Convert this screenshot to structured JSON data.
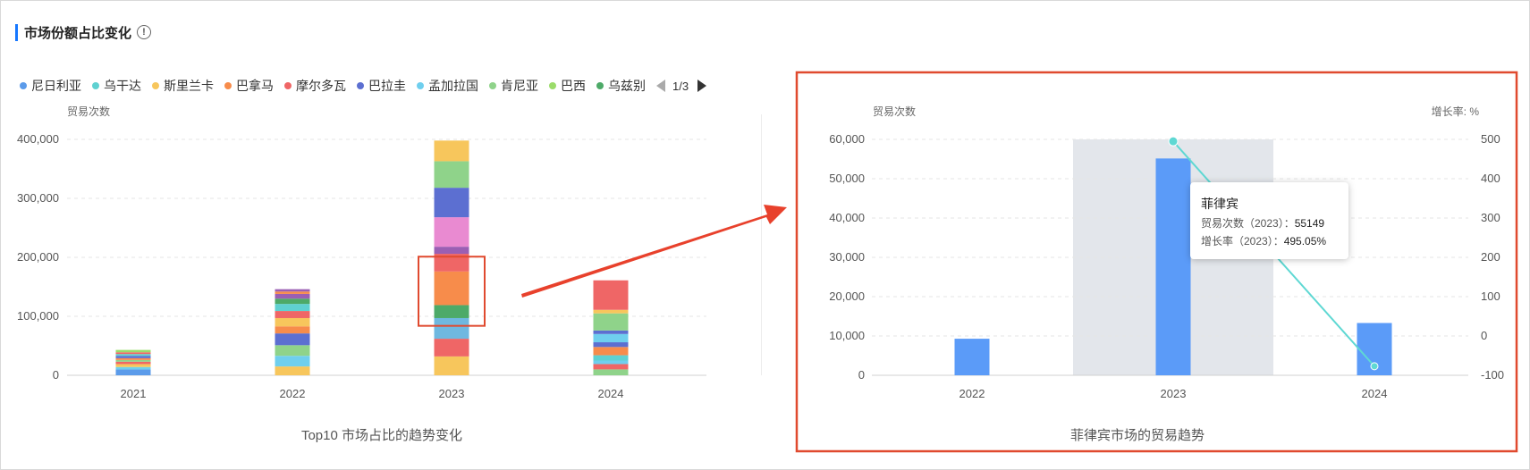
{
  "section": {
    "title": "市场份额占比变化",
    "info_icon": "info-circle-icon"
  },
  "legend": {
    "items": [
      {
        "name": "尼日利亚",
        "color": "#5b9bea"
      },
      {
        "name": "乌干达",
        "color": "#5fd1d1"
      },
      {
        "name": "斯里兰卡",
        "color": "#f7c65c"
      },
      {
        "name": "巴拿马",
        "color": "#f78c4b"
      },
      {
        "name": "摩尔多瓦",
        "color": "#ef6666"
      },
      {
        "name": "巴拉圭",
        "color": "#5c6fd1"
      },
      {
        "name": "孟加拉国",
        "color": "#6fcfee"
      },
      {
        "name": "肯尼亚",
        "color": "#8fd38a"
      },
      {
        "name": "巴西",
        "color": "#9bdc6a"
      },
      {
        "name": "乌兹别",
        "color": "#4daa68"
      }
    ],
    "page": "1/3"
  },
  "left_chart": {
    "type": "bar",
    "stacked": true,
    "title": "Top10 市场占比的趋势变化",
    "ylabel": "贸易次数",
    "ylim": [
      0,
      400000
    ],
    "yticks": [
      "0",
      "100,000",
      "200,000",
      "300,000",
      "400,000"
    ],
    "categories": [
      "2021",
      "2022",
      "2023",
      "2024"
    ],
    "stack_colors": [
      [
        "#5b9bea",
        "#6fcfee",
        "#f7c65c",
        "#ef6666",
        "#8fd38a",
        "#f78c4b",
        "#5c6fd1",
        "#5fd1d1",
        "#ef6666",
        "#9bdc6a"
      ],
      [
        "#f7c65c",
        "#6fcfee",
        "#8fd38a",
        "#5c6fd1",
        "#f78c4b",
        "#f7c65c",
        "#ef6666",
        "#5fd1d1",
        "#4daa68",
        "#9b5fb3",
        "#f78c4b",
        "#9b5fb3"
      ],
      [
        "#f7c65c",
        "#ef6666",
        "#6fb8e0",
        "#4daa68",
        "#f78c4b",
        "#ef6666",
        "#9b5fb3",
        "#e98ad1",
        "#5c6fd1",
        "#8fd38a",
        "#f7c65c"
      ],
      [
        "#8fd38a",
        "#ef6666",
        "#6fcfee",
        "#5fd1d1",
        "#f78c4b",
        "#5c6fd1",
        "#6fcfee",
        "#5c6fd1",
        "#8fd38a",
        "#f7c65c",
        "#ef6666"
      ]
    ],
    "stack_values": [
      [
        10000,
        4000,
        5000,
        4000,
        3000,
        3000,
        4000,
        3000,
        3000,
        4000
      ],
      [
        15000,
        18000,
        18000,
        20000,
        12000,
        14000,
        12000,
        12000,
        9000,
        8000,
        4000,
        4000
      ],
      [
        32000,
        30000,
        35000,
        22000,
        57000,
        30000,
        12000,
        50000,
        50000,
        45000,
        35000
      ],
      [
        10000,
        9000,
        6000,
        9000,
        14000,
        8000,
        14000,
        6000,
        29000,
        6000,
        50000
      ]
    ],
    "highlight": {
      "category": "2023",
      "from": 99000,
      "to": 186000
    }
  },
  "right_chart": {
    "type": "bar",
    "title": "菲律宾市场的贸易趋势",
    "ylabel_left": "贸易次数",
    "ylabel_right": "增长率: %",
    "ylim_left": [
      0,
      60000
    ],
    "ylim_right": [
      -100,
      500
    ],
    "yticks_left": [
      "0",
      "10,000",
      "20,000",
      "30,000",
      "40,000",
      "50,000",
      "60,000"
    ],
    "yticks_right": [
      "-100",
      "0",
      "100",
      "200",
      "300",
      "400",
      "500"
    ],
    "categories": [
      "2022",
      "2023",
      "2024"
    ],
    "series": [
      {
        "type": "bar",
        "values": [
          9300,
          55149,
          13300
        ],
        "color": "#5b9bf8"
      },
      {
        "type": "line",
        "values": [
          495.05,
          -77
        ],
        "x": [
          "2023",
          "2024"
        ],
        "color": "#5fd8d3"
      }
    ],
    "hovered": "2023"
  },
  "tooltip": {
    "title": "菲律宾",
    "row1_label": "贸易次数（2023）：",
    "row1_value": "55149",
    "row2_label": "增长率（2023）：",
    "row2_value": "495.05%"
  },
  "annotation": {
    "box_color": "#e04a2f",
    "arrow_color": "#e8412c"
  }
}
